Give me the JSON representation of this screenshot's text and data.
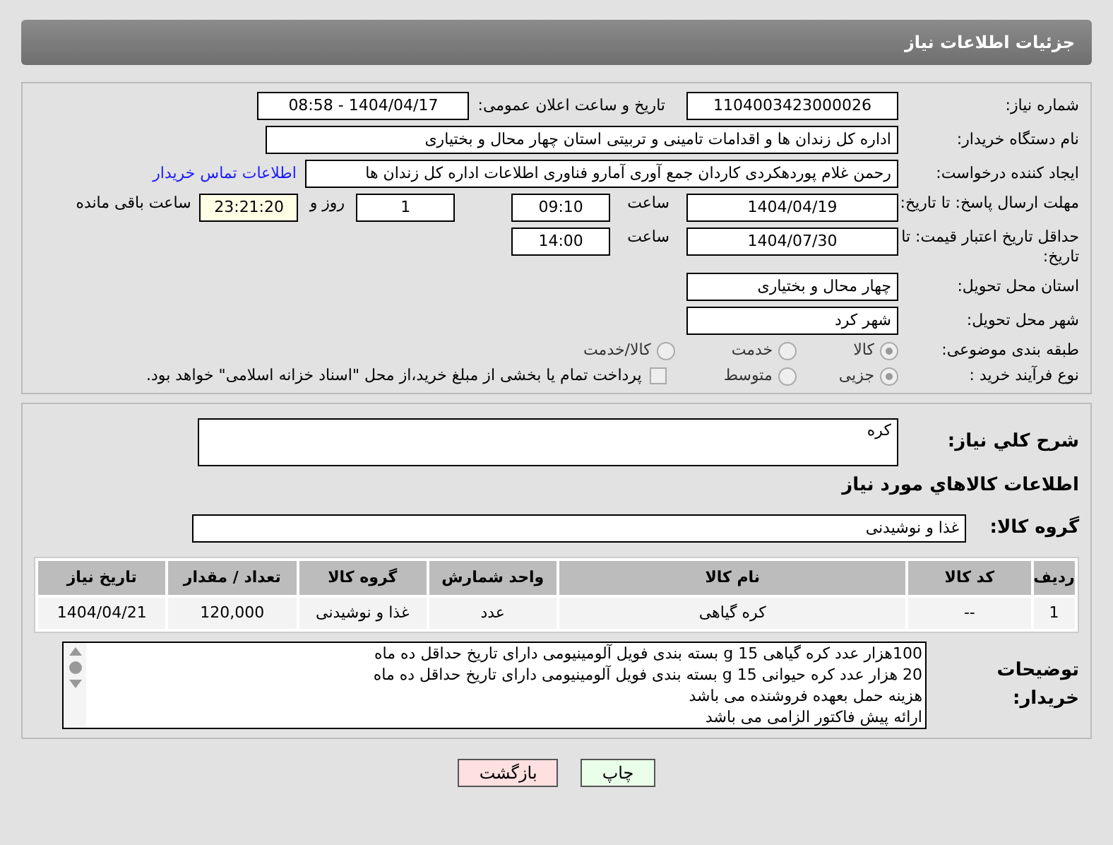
{
  "header": {
    "title": "جزئیات اطلاعات نیاز"
  },
  "need_number": {
    "label": "شماره نیاز:",
    "value": "1104003423000026"
  },
  "announce": {
    "label": "تاریخ و ساعت اعلان عمومی:",
    "value": "1404/04/17 - 08:58"
  },
  "buyer_org": {
    "label": "نام دستگاه خریدار:",
    "value": "اداره کل زندان ها و اقدامات تامینی و تربیتی استان چهار محال و بختیاری"
  },
  "requester": {
    "label": "ایجاد کننده درخواست:",
    "value": "رحمن غلام پوردهکردی کاردان جمع آوری آمارو فناوری اطلاعات اداره کل زندان ها",
    "link": "اطلاعات تماس خریدار"
  },
  "reply_deadline": {
    "label": "مهلت ارسال پاسخ: تا تاریخ:",
    "date": "1404/04/19",
    "time_label": "ساعت",
    "time": "09:10",
    "days": "1",
    "days_label": "روز و",
    "remaining": "23:21:20",
    "remaining_label": "ساعت باقی مانده"
  },
  "price_validity": {
    "label": "حداقل تاریخ اعتبار قیمت: تا تاریخ:",
    "date": "1404/07/30",
    "time_label": "ساعت",
    "time": "14:00"
  },
  "province": {
    "label": "استان محل تحویل:",
    "value": "چهار محال و بختیاری"
  },
  "city": {
    "label": "شهر محل تحویل:",
    "value": "شهر کرد"
  },
  "category": {
    "label": "طبقه بندی موضوعی:",
    "options": [
      {
        "label": "کالا",
        "selected": true
      },
      {
        "label": "خدمت",
        "selected": false
      },
      {
        "label": "کالا/خدمت",
        "selected": false
      }
    ]
  },
  "purchase_type": {
    "label": "نوع فرآیند خرید :",
    "options": [
      {
        "label": "جزیی",
        "selected": true
      },
      {
        "label": "متوسط",
        "selected": false
      }
    ],
    "treasury": {
      "checked": false,
      "label": "پرداخت تمام یا بخشی از مبلغ خرید،از محل \"اسناد خزانه اسلامی\" خواهد بود."
    }
  },
  "summary": {
    "label": "شرح كلي نياز:",
    "value": "کره"
  },
  "goods_heading": "اطلاعات كالاهاي مورد نياز",
  "goods_group": {
    "label": "گروه کالا:",
    "value": "غذا و نوشیدنی"
  },
  "table": {
    "columns": [
      "ردیف",
      "کد کالا",
      "نام کالا",
      "واحد شمارش",
      "گروه کالا",
      "تعداد / مقدار",
      "تاریخ نیاز"
    ],
    "rows": [
      [
        "1",
        "--",
        "کره گیاهی",
        "عدد",
        "غذا و نوشیدنی",
        "120,000",
        "1404/04/21"
      ]
    ]
  },
  "buyer_notes": {
    "label": "توضیحات خریدار:",
    "lines": [
      "100هزار عدد کره گیاهی 15 g بسته بندی فویل آلومینیومی دارای تاریخ حداقل ده ماه",
      "20 هزار عدد کره حیوانی 15 g بسته بندی فویل آلومینیومی دارای تاریخ حداقل ده ماه",
      "هزینه حمل بعهده فروشنده می باشد",
      "ارائه پیش فاکتور الزامی می باشد"
    ]
  },
  "buttons": [
    {
      "kind": "print",
      "label": "چاپ"
    },
    {
      "kind": "back",
      "label": "بازگشت"
    }
  ]
}
